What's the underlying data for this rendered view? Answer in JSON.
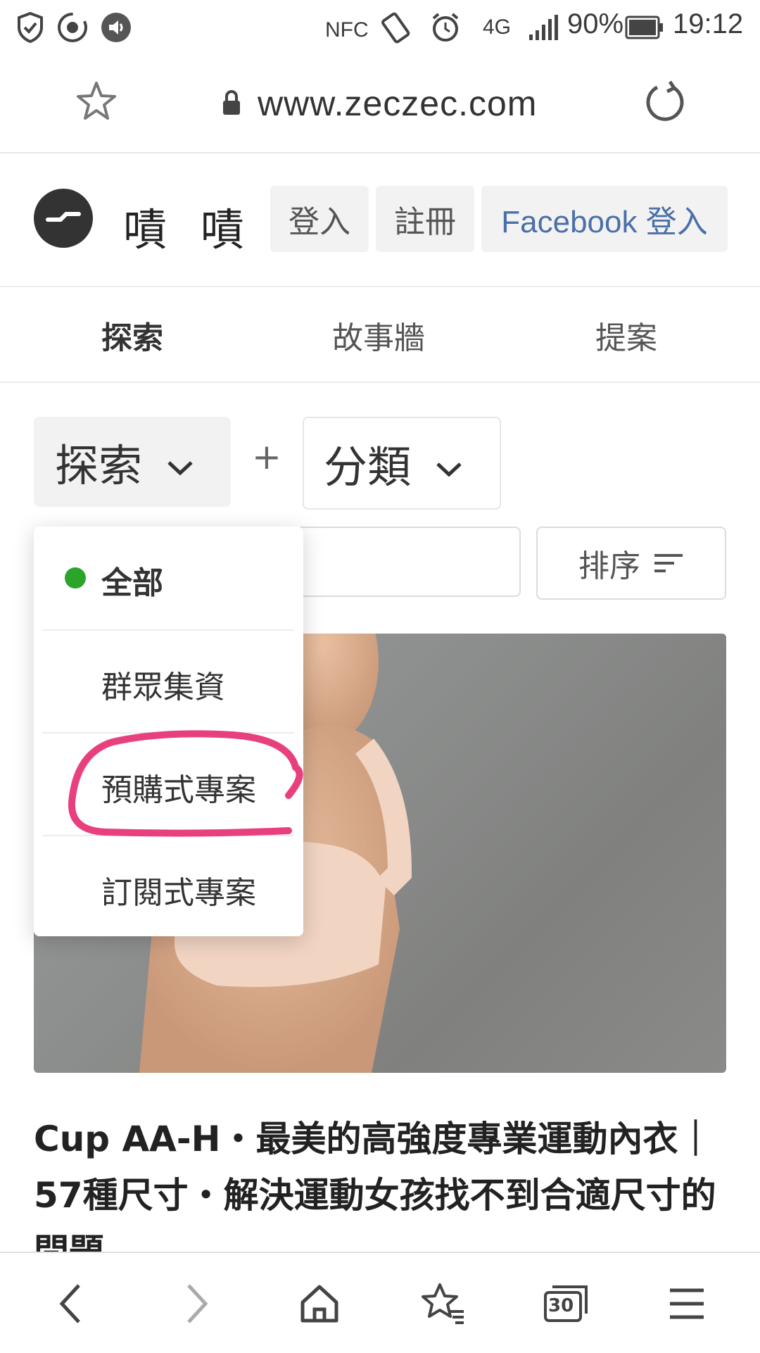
{
  "status_bar": {
    "nfc": "NFC",
    "network": "4G",
    "battery": "90%",
    "time": "19:12"
  },
  "browser": {
    "url": "www.zeczec.com"
  },
  "site": {
    "name": "嘖 嘖",
    "login_label": "登入",
    "register_label": "註冊",
    "facebook_login_label": "Facebook 登入"
  },
  "tabs": [
    {
      "label": "探索",
      "active": true
    },
    {
      "label": "故事牆",
      "active": false
    },
    {
      "label": "提案",
      "active": false
    }
  ],
  "filters": {
    "explore_label": "探索",
    "plus": "+",
    "category_label": "分類",
    "sort_label": "排序"
  },
  "dropdown": {
    "items": [
      {
        "label": "全部",
        "selected": true
      },
      {
        "label": "群眾集資",
        "selected": false
      },
      {
        "label": "預購式專案",
        "selected": false
      },
      {
        "label": "訂閱式專案",
        "selected": false
      }
    ],
    "selected_dot_color": "#2aa52a"
  },
  "project": {
    "title": "Cup AA-H・最美的高強度專業運動內衣｜57種尺寸・解決運動女孩找不到合適尺寸的問題"
  },
  "annotation": {
    "color": "#e8407e"
  },
  "bottom_nav": {
    "tab_count": "30"
  }
}
